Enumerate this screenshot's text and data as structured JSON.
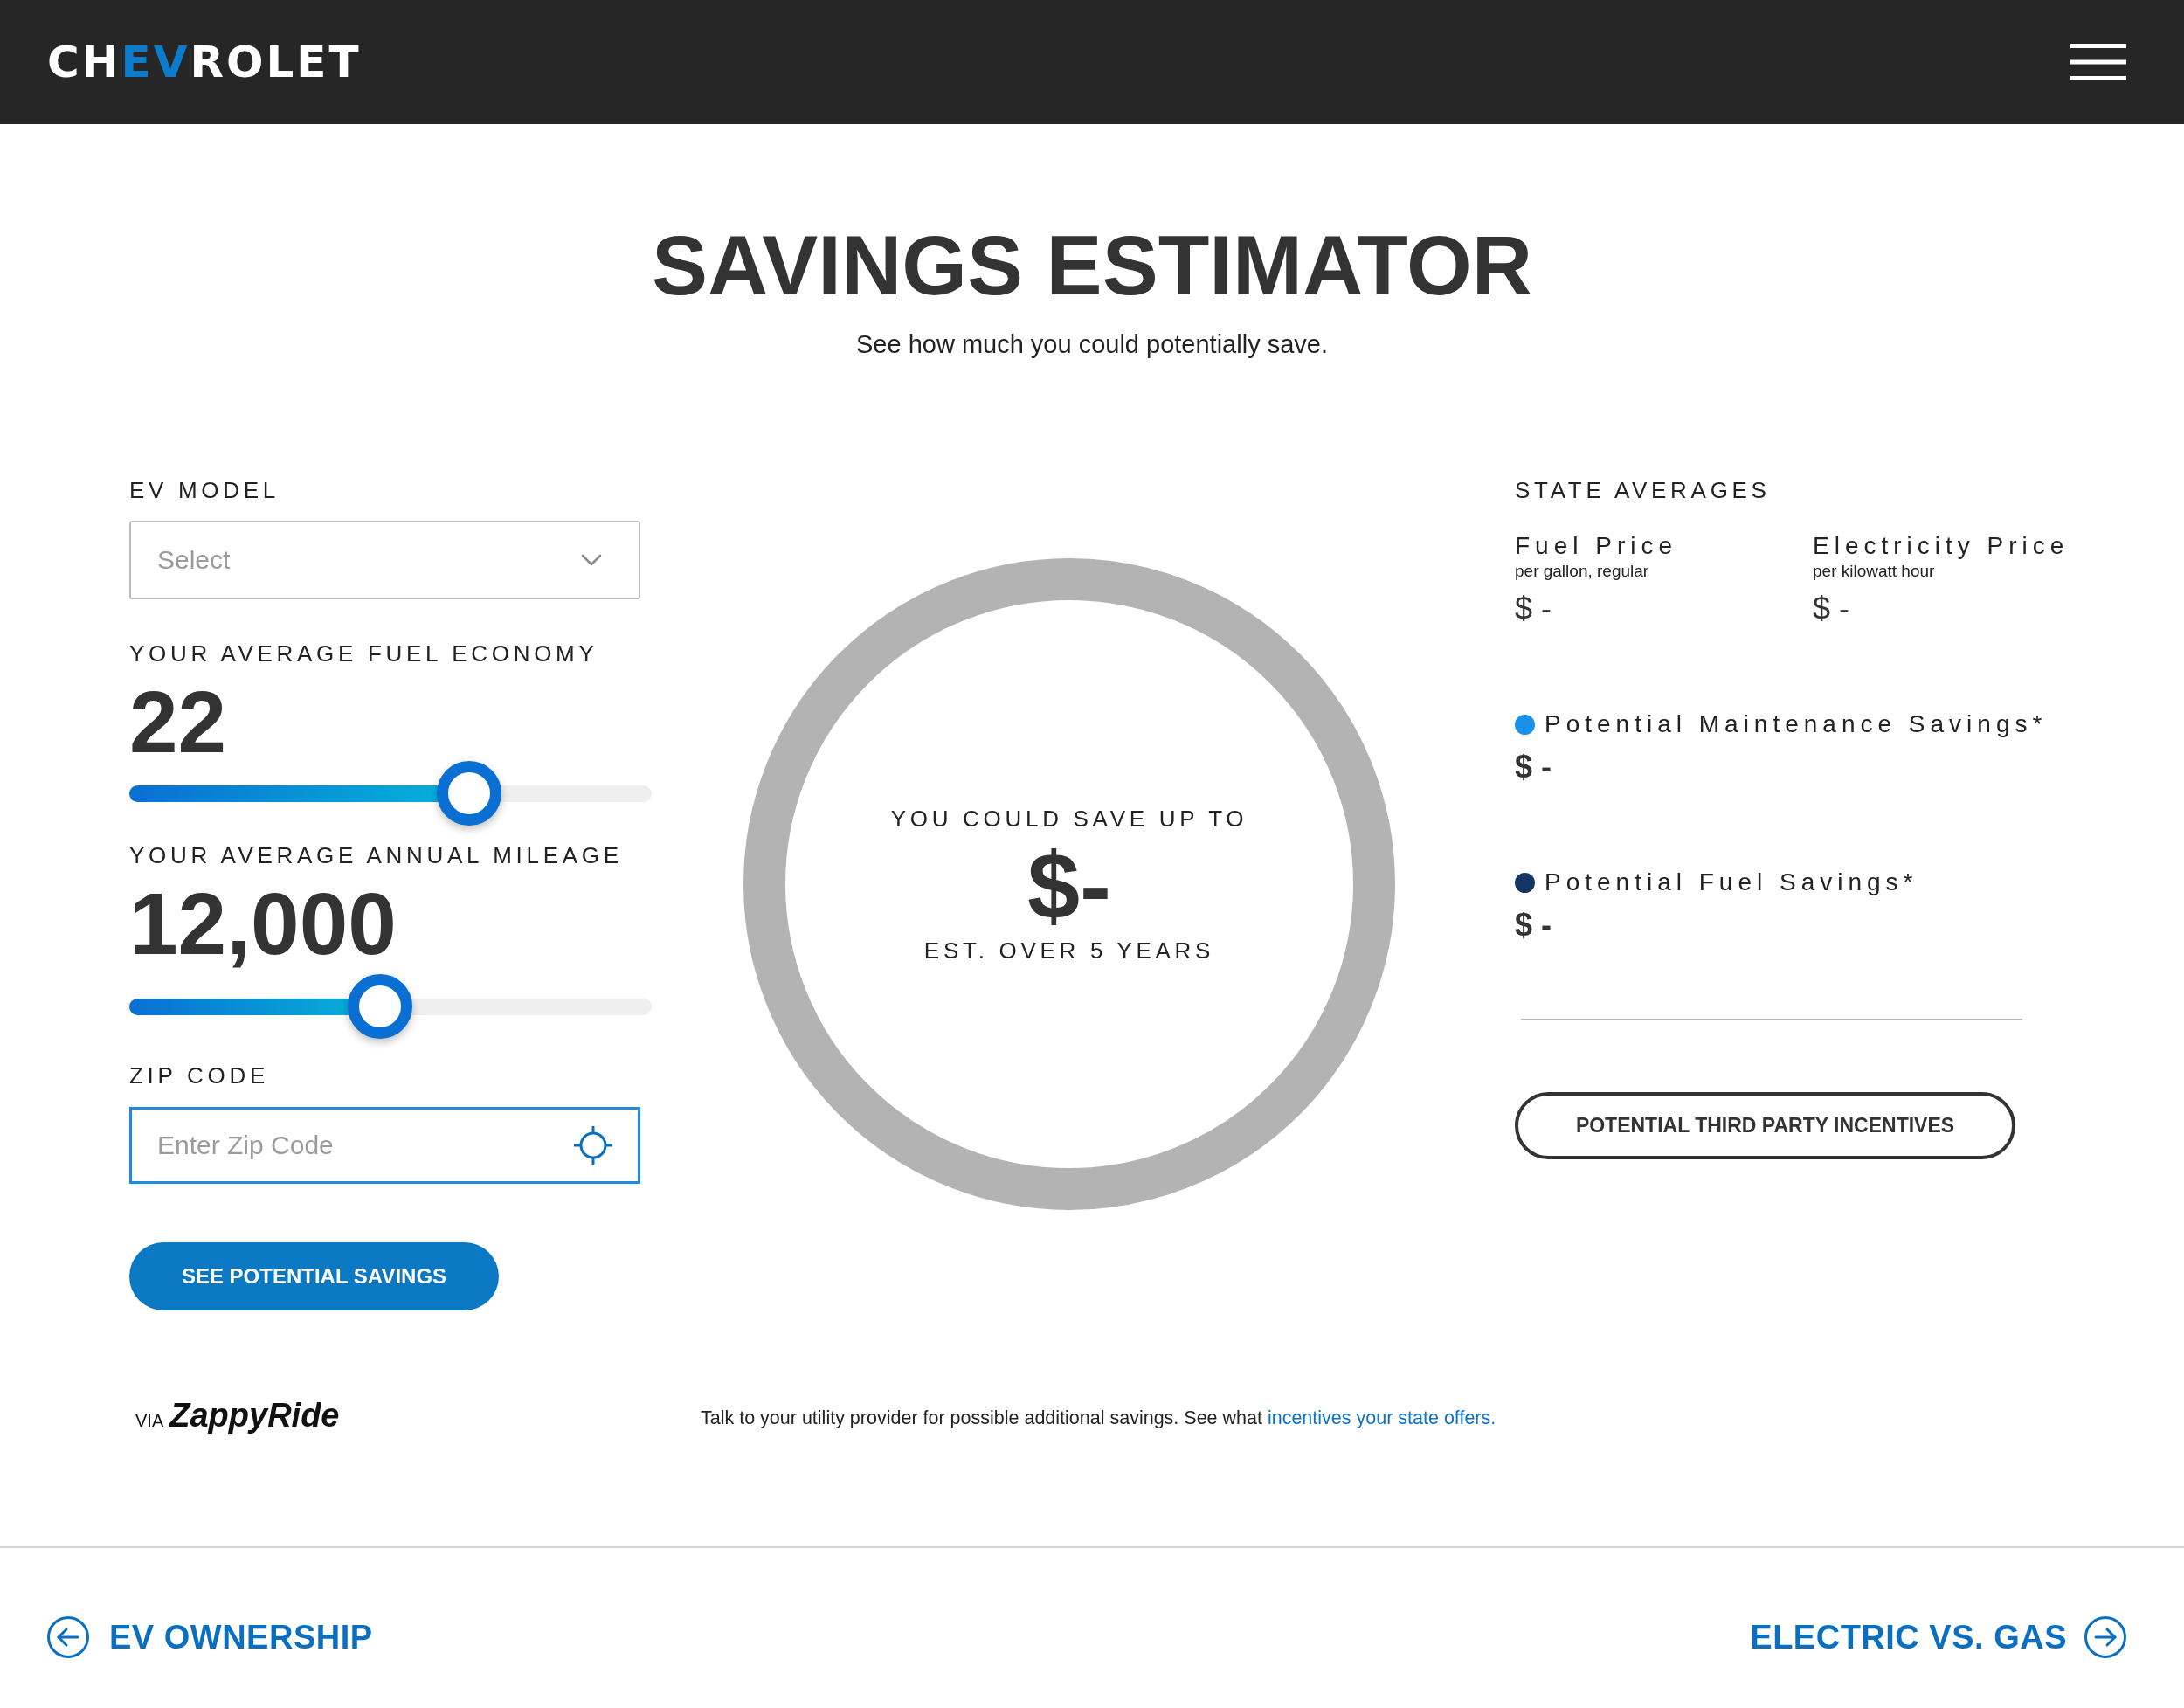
{
  "header": {
    "logo": [
      {
        "text": "CH",
        "accent": false
      },
      {
        "text": "EV",
        "accent": true
      },
      {
        "text": "ROLET",
        "accent": false
      }
    ]
  },
  "intro": {
    "title": "SAVINGS ESTIMATOR",
    "subtitle": "See how much you could potentially save."
  },
  "form": {
    "ev_model": {
      "label": "EV MODEL",
      "placeholder": "Select"
    },
    "sliders": [
      {
        "label": "YOUR AVERAGE FUEL ECONOMY",
        "value": "22",
        "level": 0.65
      },
      {
        "label": "YOUR AVERAGE ANNUAL MILEAGE",
        "value": "12,000",
        "level": 0.48
      }
    ],
    "zip_code": {
      "label": "ZIP CODE",
      "placeholder": "Enter Zip Code"
    },
    "submit_button": "SEE POTENTIAL SAVINGS"
  },
  "summary": {
    "heading": "YOU COULD SAVE UP TO",
    "amount": "$-",
    "period": "EST. OVER 5 YEARS"
  },
  "state_averages": {
    "heading": "STATE AVERAGES",
    "prices": [
      {
        "name": "Fuel Price",
        "unit": "per gallon, regular",
        "value": "$ -"
      },
      {
        "name": "Electricity Price",
        "unit": "per kilowatt hour",
        "value": "$ -"
      }
    ]
  },
  "savings": [
    {
      "label": "Potential Maintenance Savings*",
      "value": "$ -",
      "color": "#1a90e6"
    },
    {
      "label": "Potential Fuel Savings*",
      "value": "$ -",
      "color": "#143462"
    }
  ],
  "incentives_button": "POTENTIAL THIRD PARTY INCENTIVES",
  "credit": {
    "prefix": "VIA",
    "brand": "ZappyRide"
  },
  "note": {
    "text": "Talk to your utility provider for possible additional savings. See what ",
    "link": "incentives your state offers."
  },
  "footer_nav": [
    {
      "label": "EV OWNERSHIP",
      "kind": "previous"
    },
    {
      "label": "ELECTRIC VS. GAS",
      "kind": "next"
    }
  ]
}
